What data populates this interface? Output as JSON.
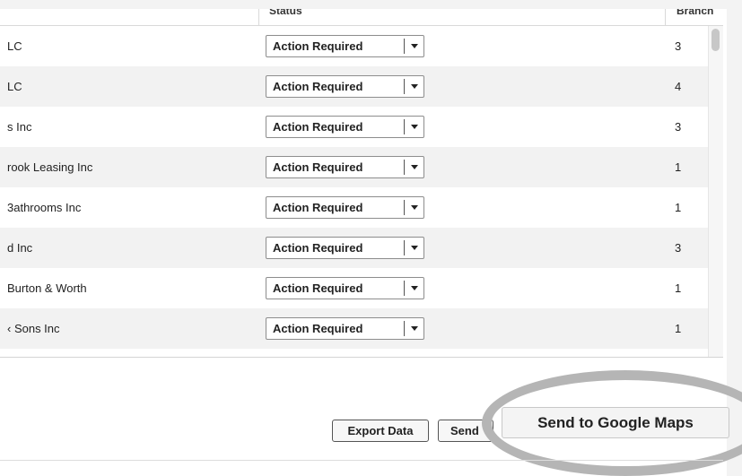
{
  "table": {
    "headers": {
      "status": "Status",
      "branches": "Branch"
    },
    "rows": [
      {
        "name": "LC",
        "status": "Action Required",
        "branches": "3"
      },
      {
        "name": "LC",
        "status": "Action Required",
        "branches": "4"
      },
      {
        "name": "s Inc",
        "status": "Action Required",
        "branches": "3"
      },
      {
        "name": "rook Leasing Inc",
        "status": "Action Required",
        "branches": "1"
      },
      {
        "name": "3athrooms Inc",
        "status": "Action Required",
        "branches": "1"
      },
      {
        "name": "d Inc",
        "status": "Action Required",
        "branches": "3"
      },
      {
        "name": "Burton & Worth",
        "status": "Action Required",
        "branches": "1"
      },
      {
        "name": "‹ Sons Inc",
        "status": "Action Required",
        "branches": "1"
      }
    ]
  },
  "actions": {
    "export_label": "Export Data",
    "send_label": "Send",
    "maps_label": "Send to Google Maps"
  },
  "icons": {
    "dropdown": "chevron-down-icon"
  },
  "colors": {
    "highlight": "#b5b5b5",
    "row_alt": "#f2f2f2"
  }
}
